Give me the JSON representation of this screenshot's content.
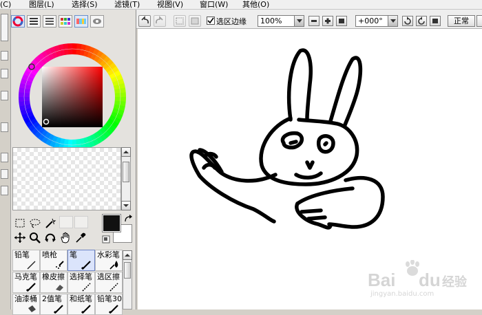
{
  "menu": {
    "items": [
      "图层(L)",
      "选择(S)",
      "滤镜(T)",
      "视图(V)",
      "窗口(W)",
      "其他(O)"
    ],
    "partial_first": "(C)"
  },
  "toolbar": {
    "selection_edge_label": "选区边缘",
    "selection_edge_checked": true,
    "zoom_value": "100%",
    "rotate_value": "+000°",
    "blend_mode": "正常"
  },
  "tools": {
    "rows": [
      [
        "rect-select",
        "lasso-select",
        "magic-wand",
        "",
        ""
      ],
      [
        "move",
        "zoom",
        "rotate-view",
        "hand",
        "eyedropper"
      ]
    ]
  },
  "colors": {
    "primary": "#111111",
    "secondary": "#ffffff",
    "ring_marker": "#ff3333"
  },
  "brushes": {
    "items": [
      {
        "label": "铅笔",
        "icon": "pencil-icon",
        "selected": false
      },
      {
        "label": "喷枪",
        "icon": "airbrush-icon",
        "selected": false
      },
      {
        "label": "笔",
        "icon": "pen-icon",
        "selected": true
      },
      {
        "label": "水彩笔",
        "icon": "watercolor-icon",
        "selected": false
      },
      {
        "label": "马克笔",
        "icon": "marker-icon",
        "selected": false
      },
      {
        "label": "橡皮擦",
        "icon": "eraser-icon",
        "selected": false
      },
      {
        "label": "选择笔",
        "icon": "select-pen-icon",
        "selected": false
      },
      {
        "label": "选区擦",
        "icon": "select-eraser-icon",
        "selected": false
      },
      {
        "label": "油漆桶",
        "icon": "bucket-icon",
        "selected": false
      },
      {
        "label": "2值笔",
        "icon": "binary-pen-icon",
        "selected": false
      },
      {
        "label": "和纸笔",
        "icon": "washi-pen-icon",
        "selected": false
      },
      {
        "label": "铅笔30",
        "icon": "pencil30-icon",
        "selected": false
      }
    ]
  },
  "watermark": {
    "brand": "Bai",
    "brand2": "du",
    "cn": "经验",
    "url": "jingyan.baidu.com"
  }
}
